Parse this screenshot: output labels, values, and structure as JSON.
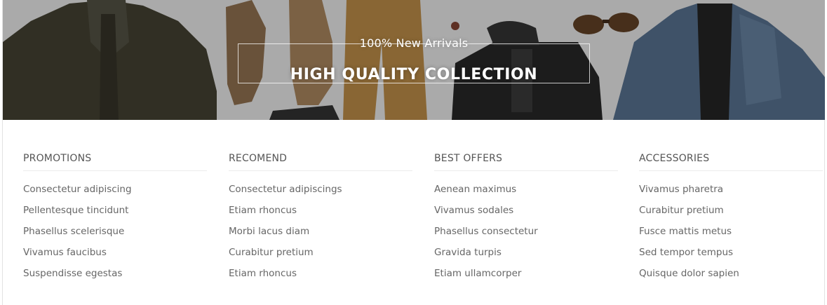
{
  "banner": {
    "kicker": "100% New Arrivals",
    "title": "HIGH QUALITY COLLECTION"
  },
  "menu": {
    "columns": [
      {
        "heading": "PROMOTIONS",
        "items": [
          "Consectetur adipiscing",
          "Pellentesque tincidunt",
          "Phasellus scelerisque",
          "Vivamus faucibus",
          "Suspendisse egestas"
        ]
      },
      {
        "heading": "RECOMEND",
        "items": [
          "Consectetur adipiscings",
          "Etiam rhoncus",
          "Morbi lacus diam",
          "Curabitur pretium",
          "Etiam rhoncus"
        ]
      },
      {
        "heading": "BEST OFFERS",
        "items": [
          "Aenean maximus",
          "Vivamus sodales",
          "Phasellus consectetur",
          "Gravida turpis",
          "Etiam ullamcorper"
        ]
      },
      {
        "heading": "ACCESSORIES",
        "items": [
          "Vivamus pharetra",
          "Curabitur pretium",
          "Fusce mattis metus",
          "Sed tempor tempus",
          "Quisque dolor sapien"
        ]
      }
    ]
  }
}
